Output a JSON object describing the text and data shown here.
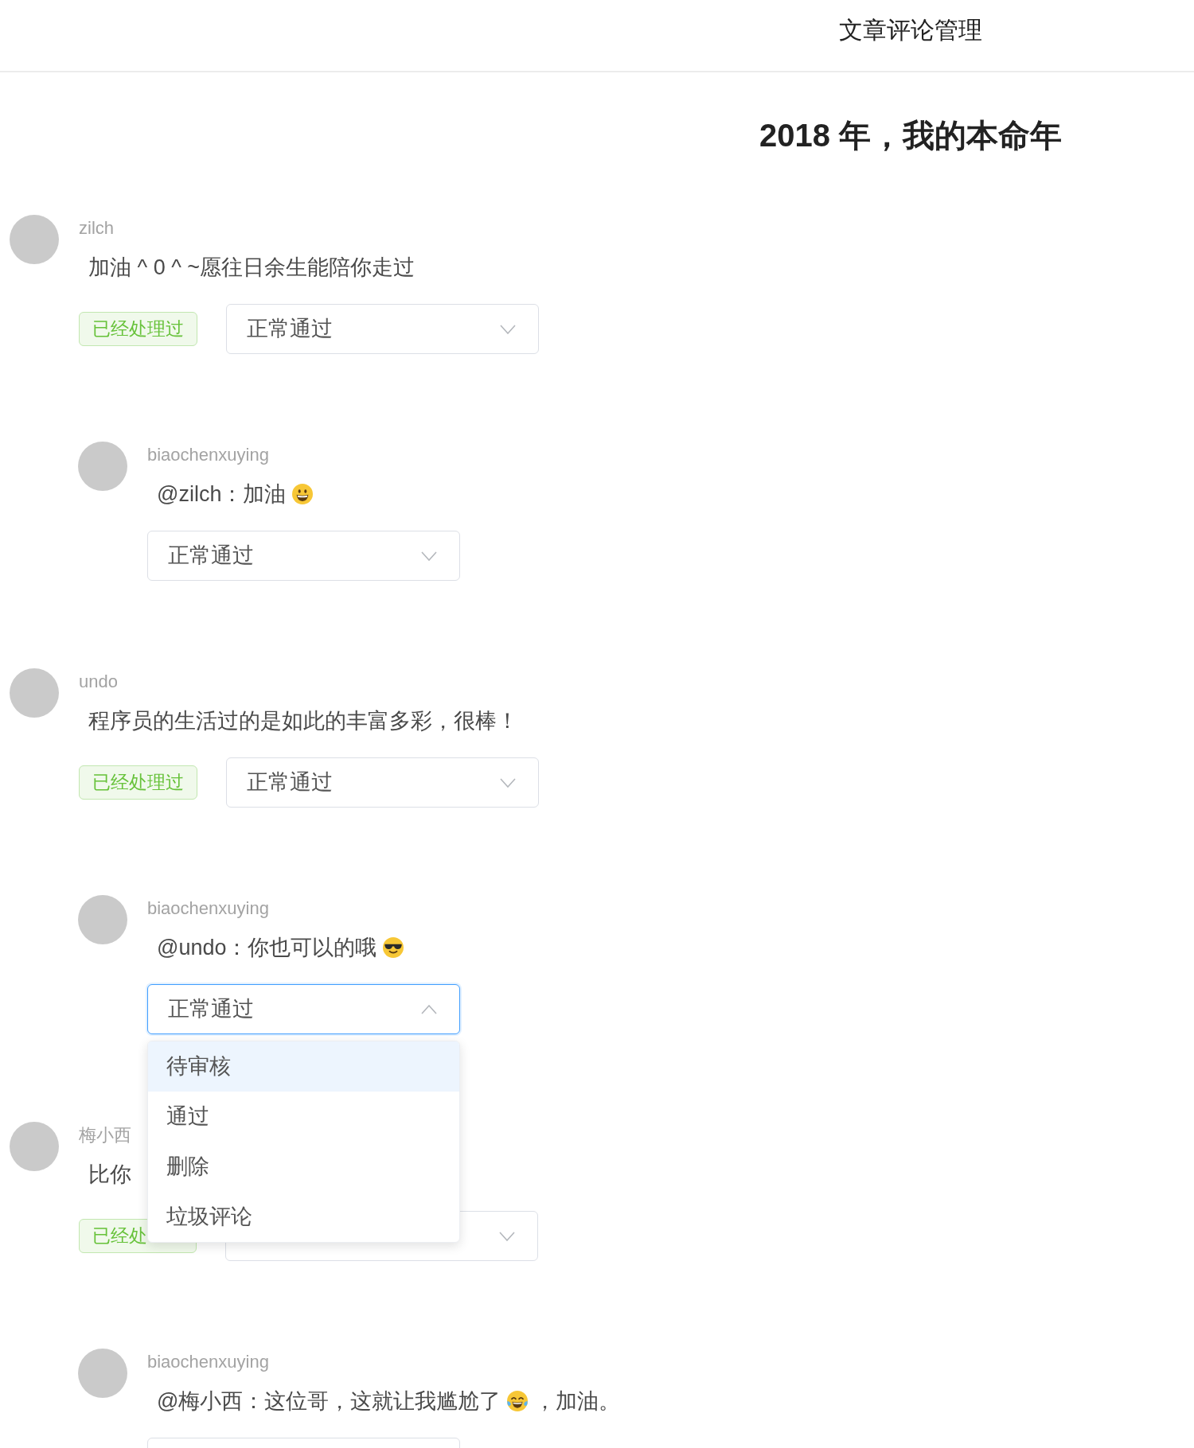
{
  "header": {
    "title": "文章评论管理"
  },
  "article": {
    "title": "2018 年，我的本命年"
  },
  "comments": [
    {
      "username": "zilch",
      "content": [
        {
          "kind": "text",
          "text": "加油 ^ 0 ^ ~愿往日余生能陪你走过"
        }
      ],
      "tag": "已经处理过",
      "select": {
        "value": "正常通过",
        "open": false
      },
      "replies": [
        {
          "username": "biaochenxuying",
          "content": [
            {
              "kind": "text",
              "text": "@zilch：加油"
            },
            {
              "kind": "grinning"
            }
          ],
          "select": {
            "value": "正常通过",
            "open": false
          }
        }
      ]
    },
    {
      "username": "undo",
      "content": [
        {
          "kind": "text",
          "text": "程序员的生活过的是如此的丰富多彩，很棒！"
        }
      ],
      "tag": "已经处理过",
      "select": {
        "value": "正常通过",
        "open": false
      },
      "replies": [
        {
          "username": "biaochenxuying",
          "content": [
            {
              "kind": "text",
              "text": "@undo：你也可以的哦"
            },
            {
              "kind": "sunglasses"
            }
          ],
          "select": {
            "value": "正常通过",
            "open": true,
            "options": [
              {
                "label": "待审核",
                "highlighted": true
              },
              {
                "label": "通过",
                "highlighted": false
              },
              {
                "label": "删除",
                "highlighted": false
              },
              {
                "label": "垃圾评论",
                "highlighted": false
              }
            ]
          }
        }
      ]
    },
    {
      "username": "梅小西",
      "content": [
        {
          "kind": "text",
          "text": "比你"
        }
      ],
      "tag": "已经处",
      "select": {
        "open": false
      },
      "replies": [
        {
          "username": "biaochenxuying",
          "content": [
            {
              "kind": "text",
              "text": "@梅小西：这位哥，这就让我尴尬了"
            },
            {
              "kind": "tears_of_joy"
            },
            {
              "kind": "text",
              "text": "，加油。"
            }
          ],
          "select": {
            "open": false
          }
        }
      ]
    }
  ]
}
